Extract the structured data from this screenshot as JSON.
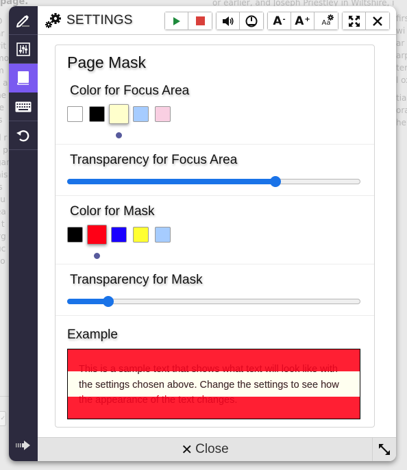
{
  "background": {
    "title_fragment": "page.",
    "top_line": "or earlier, and Joseph Priestley in Wiltshire, i",
    "left_fragments": [
      "O",
      "ar",
      "vit",
      "mo",
      "m",
      "s a",
      "he",
      "re",
      "'s",
      "",
      "d r",
      "s p",
      "gar",
      "his",
      "is",
      "su",
      "ea",
      "/ t",
      "yg",
      "uc",
      "zo"
    ],
    "right_fragments": [
      "firs",
      "wi",
      "ar",
      "arp",
      "ter",
      "l ox",
      "",
      "tial",
      "ora",
      "her"
    ]
  },
  "sidebar": {
    "items": [
      {
        "name": "pencil",
        "active": false
      },
      {
        "name": "sliders",
        "active": false
      },
      {
        "name": "book",
        "active": true
      },
      {
        "name": "keyboard",
        "active": false
      },
      {
        "name": "reset",
        "active": false
      }
    ],
    "bottom_icon": "collapse-arrow"
  },
  "header": {
    "title": "SETTINGS",
    "icon": "gears-icon",
    "toolbar": [
      {
        "group": "playback",
        "buttons": [
          "play",
          "stop"
        ]
      },
      {
        "group": "audio",
        "buttons": [
          "volume",
          "speed"
        ]
      },
      {
        "group": "text-size",
        "buttons": [
          "decrease-font",
          "increase-font",
          "font-settings"
        ]
      },
      {
        "group": "window",
        "buttons": [
          "fullscreen",
          "close"
        ]
      }
    ],
    "font_decrease_label": "A",
    "font_decrease_sign": "-",
    "font_increase_label": "A",
    "font_increase_sign": "+",
    "font_settings_label": "Aa"
  },
  "panel": {
    "title": "Page Mask",
    "focus_color": {
      "label": "Color for Focus Area",
      "options": [
        "#ffffff",
        "#000000",
        "#ffffcc",
        "#a6ccff",
        "#f9cfe2"
      ],
      "selected_index": 2
    },
    "focus_transparency": {
      "label": "Transparency for Focus Area",
      "value": 0.71
    },
    "mask_color": {
      "label": "Color for Mask",
      "options": [
        "#000000",
        "#ff0016",
        "#1a00ff",
        "#ffff33",
        "#a6ccff"
      ],
      "selected_index": 1
    },
    "mask_transparency": {
      "label": "Transparency for Mask",
      "value": 0.14
    },
    "example": {
      "label": "Example",
      "text": "This is a sample text that shows what text will look like with the settings chosen above. Change the settings to see how the appearance of the text changes."
    }
  },
  "footer": {
    "close_label": "Close",
    "close_icon": "x-icon",
    "resize_icon": "resize-diagonal-icon"
  },
  "colors": {
    "sidebar_bg": "#2c2a3e",
    "sidebar_active": "#7a5af0",
    "slider_accent": "#1a73e8",
    "selection_dot": "#575a9c",
    "play_green": "#1e8a3c",
    "stop_red": "#d9403b"
  }
}
